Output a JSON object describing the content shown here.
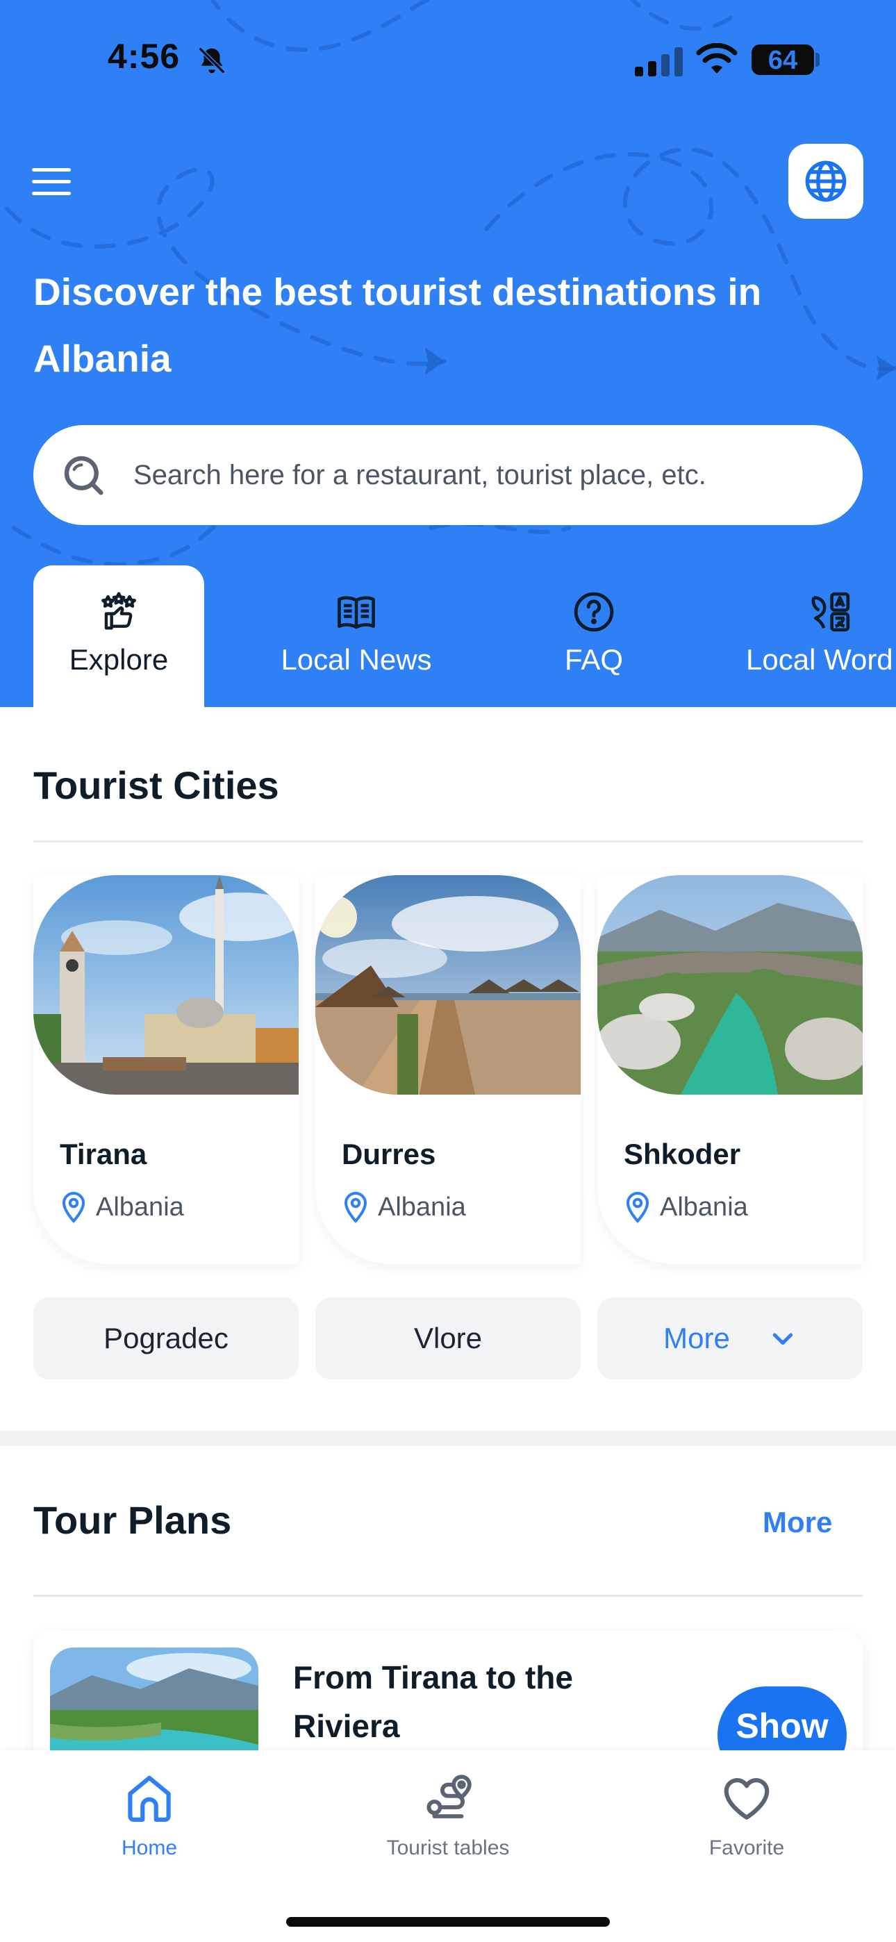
{
  "status_bar": {
    "time": "4:56",
    "battery": "64",
    "icons": [
      "bell-off-icon",
      "signal-icon",
      "wifi-icon",
      "battery-icon"
    ]
  },
  "header": {
    "headline": "Discover the best tourist destinations in Albania",
    "menu_icon": "hamburger-menu-icon",
    "language_icon": "globe-icon",
    "background_color": "#2f7ff5"
  },
  "search": {
    "placeholder": "Search here for a restaurant, tourist place, etc."
  },
  "tabs": [
    {
      "label": "Explore",
      "icon": "explore-stars-icon",
      "active": true
    },
    {
      "label": "Local News",
      "icon": "book-icon",
      "active": false
    },
    {
      "label": "FAQ",
      "icon": "question-circle-icon",
      "active": false
    },
    {
      "label": "Local Word",
      "icon": "translate-icon",
      "active": false
    }
  ],
  "tourist_cities": {
    "title": "Tourist Cities",
    "cities": [
      {
        "name": "Tirana",
        "country": "Albania"
      },
      {
        "name": "Durres",
        "country": "Albania"
      },
      {
        "name": "Shkoder",
        "country": "Albania"
      }
    ],
    "chips": [
      "Pogradec",
      "Vlore"
    ],
    "more_label": "More"
  },
  "tour_plans": {
    "title": "Tour Plans",
    "more_label": "More",
    "plans": [
      {
        "title": "From Tirana to the Riviera",
        "action": "Show"
      }
    ]
  },
  "bottom_nav": [
    {
      "label": "Home",
      "icon": "home-icon",
      "active": true
    },
    {
      "label": "Tourist tables",
      "icon": "route-icon",
      "active": false
    },
    {
      "label": "Favorite",
      "icon": "heart-icon",
      "active": false
    }
  ],
  "colors": {
    "accent": "#2f7ff5",
    "text": "#0f1d2b",
    "chip_bg": "#f2f3f5"
  }
}
